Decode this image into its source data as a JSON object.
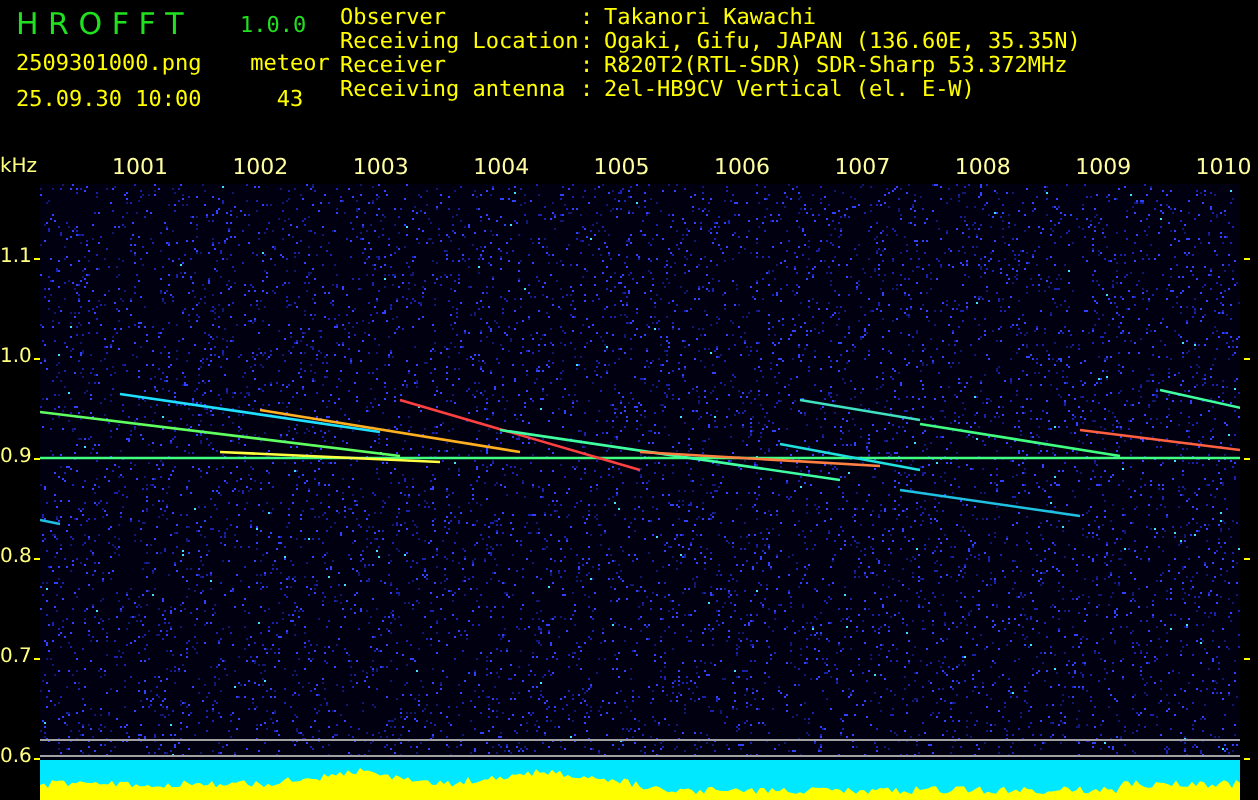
{
  "header": {
    "app_name": "H R O F F T",
    "version": "1.0.0",
    "filename": "2509301000.png",
    "datetime": "25.09.30 10:00",
    "meteor_label": "meteor",
    "meteor_count": "43"
  },
  "station": [
    {
      "label": "Observer",
      "separator": ":",
      "value": "Takanori Kawachi"
    },
    {
      "label": "Receiving Location",
      "separator": ":",
      "value": "Ogaki, Gifu, JAPAN (136.60E, 35.35N)"
    },
    {
      "label": "Receiver",
      "separator": ":",
      "value": "R820T2(RTL-SDR) SDR-Sharp 53.372MHz"
    },
    {
      "label": "Receiving antenna",
      "separator": ":",
      "value": "2el-HB9CV Vertical (el. E-W)"
    }
  ],
  "spectrogram": {
    "unit": "kHz",
    "x_ticks": [
      "1001",
      "1002",
      "1003",
      "1004",
      "1005",
      "1006",
      "1007",
      "1008",
      "1009",
      "1010"
    ],
    "y_ticks": [
      "1.1",
      "1.0",
      "0.9",
      "0.8",
      "0.7",
      "0.6"
    ]
  }
}
